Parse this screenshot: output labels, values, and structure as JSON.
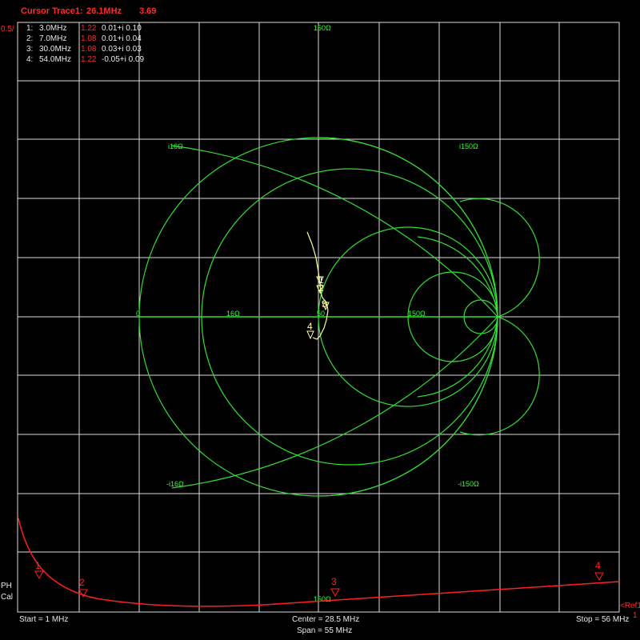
{
  "header": {
    "cursor_title": "Cursor Trace1:",
    "cursor_freq": "26.1MHz",
    "cursor_value": "3.69",
    "left_scale": "0.5/"
  },
  "markers_table": [
    {
      "idx": "1:",
      "freq": "3.0MHz",
      "swr": "1.22",
      "z": "0.01+i 0.10"
    },
    {
      "idx": "2:",
      "freq": "7.0MHz",
      "swr": "1.08",
      "z": "0.01+i 0.04"
    },
    {
      "idx": "3:",
      "freq": "30.0MHz",
      "swr": "1.08",
      "z": "0.03+i 0.03"
    },
    {
      "idx": "4:",
      "freq": "54.0MHz",
      "swr": "1.22",
      "z": "-0.05+i 0.09"
    }
  ],
  "smith_labels": {
    "top": "150Ω",
    "bottom": "150Ω",
    "left_zero": "0",
    "r16": "16Ω",
    "r50": "50",
    "r150": "150Ω",
    "upper_left": "i16Ω",
    "upper_right": "i150Ω",
    "lower_left": "-i16Ω",
    "lower_right": "-i150Ω"
  },
  "smith_markers": [
    "1",
    "2",
    "3",
    "4"
  ],
  "swr_markers": [
    "1",
    "2",
    "3",
    "4"
  ],
  "side_labels": {
    "ph": "PH",
    "cal": "Cal",
    "ref": "<Ref1",
    "ref_value": "1"
  },
  "footer": {
    "start": "Start = 1 MHz",
    "center": "Center = 28.5 MHz",
    "span": "Span = 55 MHz",
    "stop": "Stop = 56 MHz"
  },
  "colors": {
    "smith": "#33dd33",
    "trace": "#ffff99",
    "swr": "#ff2020",
    "grid": "#dddddd",
    "label": "#ff2a2a"
  }
}
